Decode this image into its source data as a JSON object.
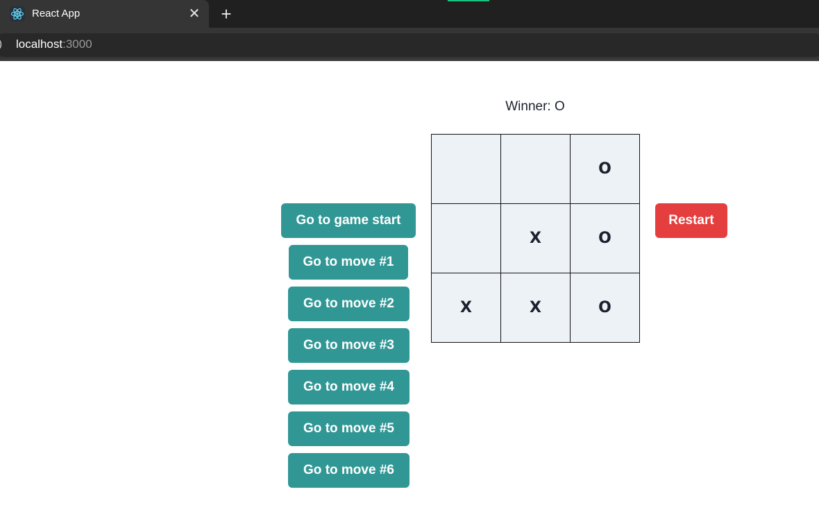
{
  "browser": {
    "tab_title": "React App",
    "tab_favicon": "react-logo-icon",
    "close_glyph": "✕",
    "new_tab_glyph": "+",
    "site_info_glyph": ")",
    "url_host": "localhost",
    "url_port": ":3000",
    "accent_color": "#16c47f"
  },
  "game": {
    "status": "Winner: O",
    "squares": [
      "",
      "",
      "O",
      "",
      "X",
      "O",
      "X",
      "X",
      "O"
    ],
    "history": [
      "Go to game start",
      "Go to move #1",
      "Go to move #2",
      "Go to move #3",
      "Go to move #4",
      "Go to move #5",
      "Go to move #6"
    ],
    "restart_label": "Restart",
    "colors": {
      "move_button": "#319795",
      "restart_button": "#e53e3e",
      "square_bg": "#edf2f7"
    }
  }
}
